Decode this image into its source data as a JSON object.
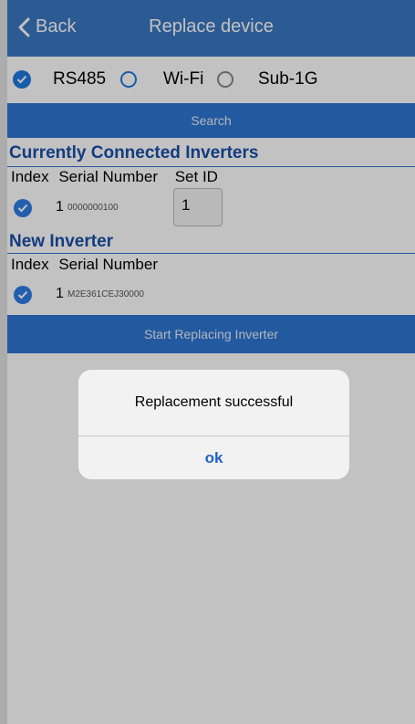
{
  "nav": {
    "back_label": "Back",
    "title": "Replace device"
  },
  "connection": {
    "options": [
      {
        "label": "RS485",
        "selected": true
      },
      {
        "label": "Wi-Fi",
        "selected": false
      },
      {
        "label": "Sub-1G",
        "selected": false
      }
    ]
  },
  "search_button": "Search",
  "current": {
    "title": "Currently Connected Inverters",
    "headers": {
      "index": "Index",
      "serial": "Serial Number",
      "set_id": "Set ID"
    },
    "rows": [
      {
        "index": "1",
        "serial": "0000000100",
        "set_id": "1"
      }
    ]
  },
  "new_inverter": {
    "title": "New Inverter",
    "headers": {
      "index": "Index",
      "serial": "Serial Number"
    },
    "rows": [
      {
        "index": "1",
        "serial": "M2E361CEJ30000"
      }
    ]
  },
  "start_button": "Start Replacing Inverter",
  "alert": {
    "message": "Replacement successful",
    "ok_label": "ok"
  },
  "colors": {
    "accent": "#3b78c2",
    "button": "#2f76d1",
    "section_title": "#1a4fa8",
    "check": "#2f7ee6"
  }
}
